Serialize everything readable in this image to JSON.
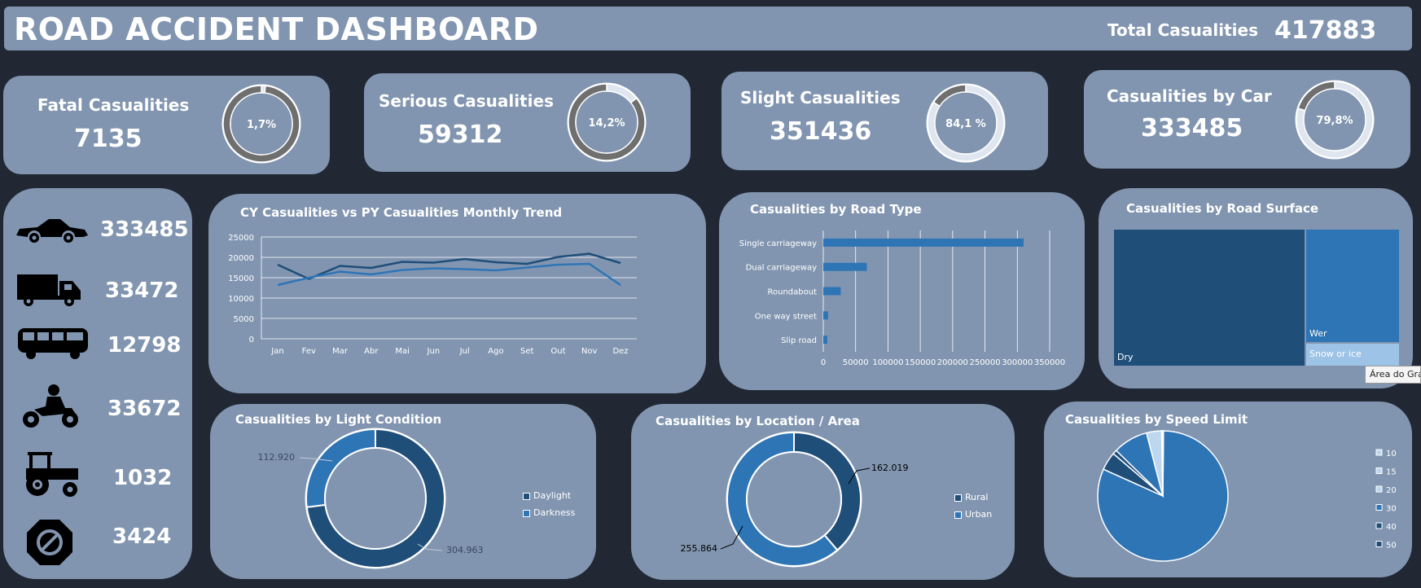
{
  "header": {
    "title": "ROAD ACCIDENT DASHBOARD",
    "total_label": "Total Casualities",
    "total_value": "417883"
  },
  "kpis": [
    {
      "title": "Fatal Casualities",
      "value": "7135",
      "pct_label": "1,7%",
      "pct": 1.7
    },
    {
      "title": "Serious Casualities",
      "value": "59312",
      "pct_label": "14,2%",
      "pct": 14.2
    },
    {
      "title": "Slight Casualities",
      "value": "351436",
      "pct_label": "84,1 %",
      "pct": 84.1
    },
    {
      "title": "Casualities by Car",
      "value": "333485",
      "pct_label": "79,8%",
      "pct": 79.8
    }
  ],
  "vehicles": [
    {
      "icon": "car-icon",
      "value": "333485"
    },
    {
      "icon": "truck-icon",
      "value": "33472"
    },
    {
      "icon": "bus-icon",
      "value": "12798"
    },
    {
      "icon": "motorcycle-icon",
      "value": "33672"
    },
    {
      "icon": "tractor-icon",
      "value": "1032"
    },
    {
      "icon": "other-vehicle-icon",
      "value": "3424"
    }
  ],
  "tooltip": "Área do Gráfico",
  "colors": {
    "background": "#212733",
    "panel": "#8195b0",
    "dark_blue": "#1f4e79",
    "mid_blue": "#2e75b6",
    "light_blue": "#bdd7ee",
    "donut_gray": "#6f6f6f",
    "donut_rest": "#dfe6f0"
  },
  "chart_data": [
    {
      "id": "monthly",
      "type": "line",
      "title": "CY Casualities vs PY Casualities Monthly Trend",
      "categories": [
        "Jan",
        "Fev",
        "Mar",
        "Abr",
        "Mai",
        "Jun",
        "Jul",
        "Ago",
        "Set",
        "Out",
        "Nov",
        "Dez"
      ],
      "series": [
        {
          "color": "#1f4e79",
          "values": [
            18200,
            14700,
            17900,
            17400,
            18900,
            18700,
            19600,
            18800,
            18400,
            20100,
            20900,
            18600
          ]
        },
        {
          "color": "#2e75b6",
          "values": [
            13200,
            15000,
            16500,
            15800,
            16900,
            17300,
            17100,
            16800,
            17500,
            18200,
            18400,
            13200
          ]
        }
      ],
      "ylim": [
        0,
        25000
      ],
      "yticks": [
        "0",
        "5000",
        "10000",
        "15000",
        "20000",
        "25000"
      ],
      "grid": true
    },
    {
      "id": "road_type",
      "type": "bar",
      "orientation": "horizontal",
      "title": "Casualities by Road Type",
      "categories": [
        "Single carriageway",
        "Dual carriageway",
        "Roundabout",
        "One way street",
        "Slip road"
      ],
      "values": [
        309698,
        67373,
        26950,
        7412,
        6158
      ],
      "xlim": [
        0,
        350000
      ],
      "xticks": [
        "0",
        "50000",
        "100000",
        "150000",
        "200000",
        "250000",
        "300000",
        "350000"
      ],
      "grid": true
    },
    {
      "id": "road_surface",
      "type": "treemap",
      "title": "Casualities by Road Surface",
      "labels": [
        "Dry",
        "Wer",
        "Snow or ice"
      ],
      "values": [
        279445,
        115261,
        23177
      ]
    },
    {
      "id": "light",
      "type": "pie",
      "variant": "donut",
      "title": "Casualities by Light Condition",
      "labels": [
        "Daylight",
        "Darkness"
      ],
      "values": [
        304963,
        112920
      ],
      "data_labels": [
        "304.963",
        "112.920"
      ],
      "legend": "right"
    },
    {
      "id": "location",
      "type": "pie",
      "variant": "donut",
      "title": "Casualities by Location / Area",
      "labels": [
        "Rural",
        "Urban"
      ],
      "values": [
        162019,
        255864
      ],
      "data_labels": [
        "162.019",
        "255.864"
      ],
      "legend": "right"
    },
    {
      "id": "speed",
      "type": "pie",
      "title": "Casualities by Speed Limit",
      "labels": [
        "10",
        "15",
        "20",
        "30",
        "40",
        "50"
      ],
      "values": [
        2,
        20,
        7800,
        262000,
        14500,
        3400
      ],
      "legend": "right"
    }
  ]
}
